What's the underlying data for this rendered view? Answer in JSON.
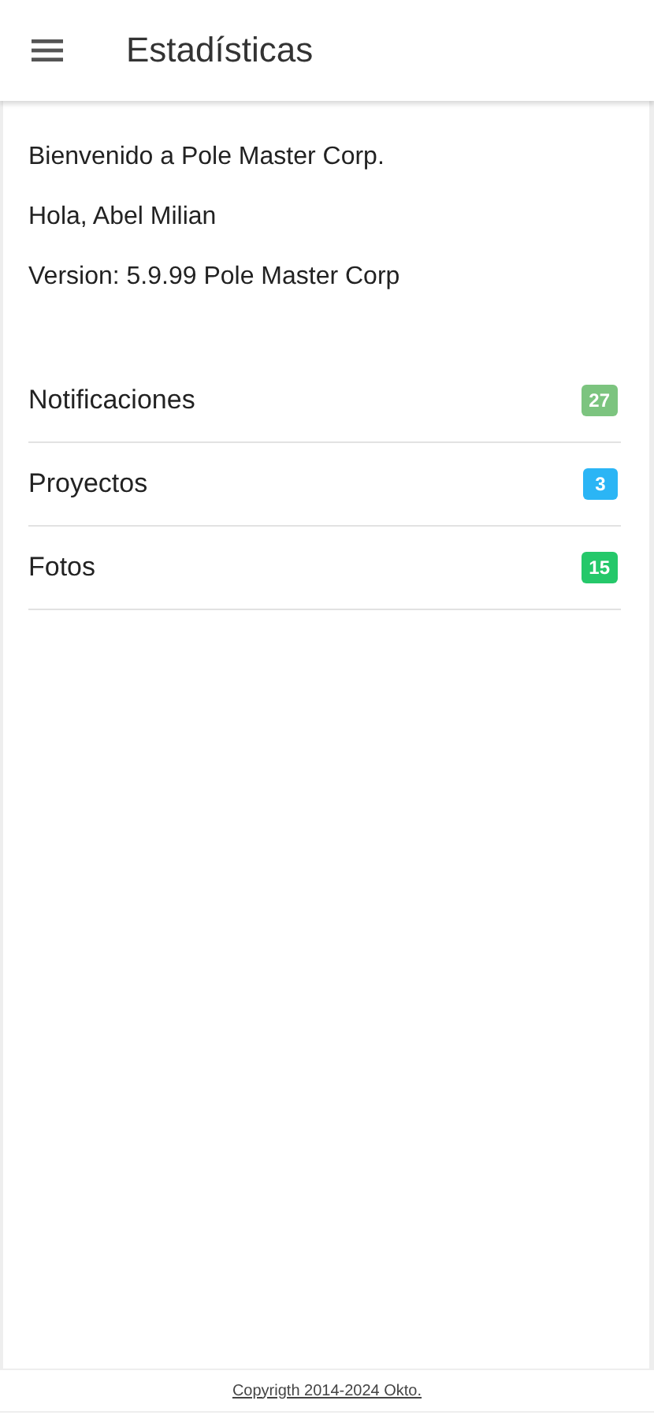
{
  "header": {
    "title": "Estadísticas"
  },
  "info": [
    "Bienvenido a Pole Master Corp.",
    "Hola, Abel Milian",
    "Version: 5.9.99 Pole Master Corp"
  ],
  "stats": [
    {
      "label": "Notificaciones",
      "count": "27",
      "color": "#7cc47f"
    },
    {
      "label": "Proyectos",
      "count": "3",
      "color": "#2bb5f5"
    },
    {
      "label": "Fotos",
      "count": "15",
      "color": "#25c86a"
    }
  ],
  "footer": {
    "copyright": "Copyrigth 2014-2024 Okto."
  }
}
